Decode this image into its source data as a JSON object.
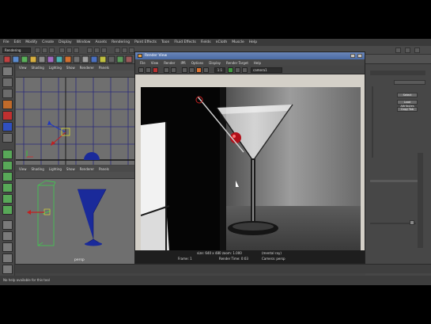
{
  "menubar": {
    "items": [
      "File",
      "Edit",
      "Modify",
      "Create",
      "Display",
      "Window",
      "Assets",
      "Rendering",
      "Paint Effects",
      "Toon",
      "Fluid Effects",
      "Fields",
      "nCloth",
      "Muscle",
      "Help"
    ],
    "mode": "Rendering"
  },
  "viewport_top": {
    "menu": [
      "View",
      "Shading",
      "Lighting",
      "Show",
      "Renderer",
      "Panels"
    ]
  },
  "viewport_bottom": {
    "menu": [
      "View",
      "Shading",
      "Lighting",
      "Show",
      "Renderer",
      "Panels"
    ],
    "camera_label": "persp"
  },
  "render_view": {
    "title": "Render View",
    "menu": [
      "File",
      "View",
      "Render",
      "IPR",
      "Options",
      "Display",
      "Render Target",
      "Help"
    ],
    "ratio": "1:1",
    "camera": "camera1",
    "stats": {
      "size": "size: 640 x 480 zoom: 1.000",
      "frame": "Frame: 1",
      "render_time": "Render Time: 0:03",
      "layer": "Layer: masterLayer",
      "camera": "Camera: persp",
      "renderer": "(mental ray)"
    }
  },
  "attribute_editor": {
    "select_btn": "Select",
    "load_btn": "Load Attributes",
    "copy_btn": "Copy Tab"
  },
  "helpline": {
    "text": "No help available for this tool"
  },
  "colors": {
    "app_bg": "#444444",
    "render_title": "#4a6aa4",
    "wine_glass_blue": "#1a2a9a",
    "bounding_green": "#38d84a",
    "cherry_red": "#b0101a"
  }
}
